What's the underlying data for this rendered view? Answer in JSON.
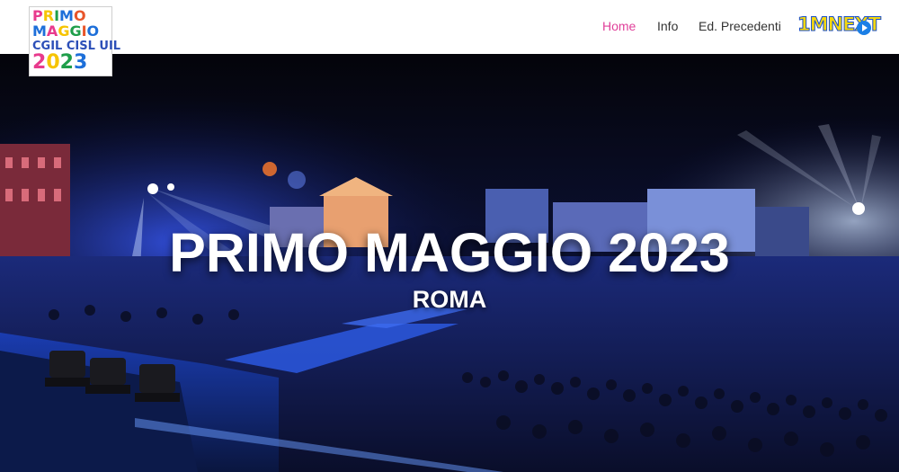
{
  "logo": {
    "line1": "PRIMO",
    "line2": "MAGGIO",
    "line3": "CGIL CISL UIL",
    "year": "2023"
  },
  "nav": {
    "items": [
      {
        "label": "Home",
        "active": true
      },
      {
        "label": "Info",
        "active": false
      },
      {
        "label": "Ed. Precedenti",
        "active": false
      }
    ],
    "active_color": "#e0409a"
  },
  "sponsor": {
    "text": "1MNEXT",
    "icon": "play-icon"
  },
  "hero": {
    "title": "PRIMO MAGGIO 2023",
    "subtitle": "ROMA"
  }
}
